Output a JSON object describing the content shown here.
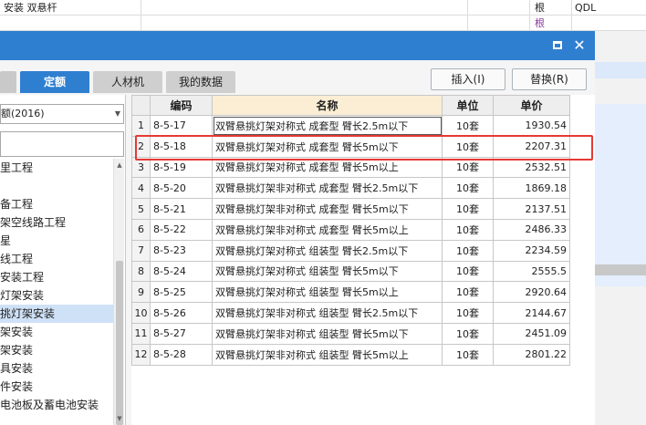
{
  "background": {
    "row1_text": "安装 双悬杆",
    "row1_unit": "根",
    "row1_code": "QDL",
    "row2_unit": "根"
  },
  "dialog": {
    "tabs": {
      "blank": "",
      "quota": "定额",
      "material": "人材机",
      "mydata": "我的数据"
    },
    "insert_label": "插入(I)",
    "replace_label": "替换(R)",
    "library_select": "额(2016)",
    "tree_items": [
      "里工程",
      "",
      "备工程",
      "架空线路工程",
      "星",
      "线工程",
      "安装工程",
      "灯架安装",
      "挑灯架安装",
      "架安装",
      "架安装",
      "具安装",
      "件安装",
      "电池板及蓄电池安装"
    ],
    "selected_tree_index": 8
  },
  "grid": {
    "headers": {
      "index": "",
      "code": "编码",
      "name": "名称",
      "unit": "单位",
      "price": "单价"
    },
    "rows": [
      {
        "index": "1",
        "code": "8-5-17",
        "name": "双臂悬挑灯架对称式 成套型 臂长2.5m以下",
        "unit": "10套",
        "price": "1930.54"
      },
      {
        "index": "2",
        "code": "8-5-18",
        "name": "双臂悬挑灯架对称式 成套型 臂长5m以下",
        "unit": "10套",
        "price": "2207.31"
      },
      {
        "index": "3",
        "code": "8-5-19",
        "name": "双臂悬挑灯架对称式 成套型 臂长5m以上",
        "unit": "10套",
        "price": "2532.51"
      },
      {
        "index": "4",
        "code": "8-5-20",
        "name": "双臂悬挑灯架非对称式 成套型 臂长2.5m以下",
        "unit": "10套",
        "price": "1869.18"
      },
      {
        "index": "5",
        "code": "8-5-21",
        "name": "双臂悬挑灯架非对称式 成套型 臂长5m以下",
        "unit": "10套",
        "price": "2137.51"
      },
      {
        "index": "6",
        "code": "8-5-22",
        "name": "双臂悬挑灯架非对称式 成套型 臂长5m以上",
        "unit": "10套",
        "price": "2486.33"
      },
      {
        "index": "7",
        "code": "8-5-23",
        "name": "双臂悬挑灯架对称式 组装型 臂长2.5m以下",
        "unit": "10套",
        "price": "2234.59"
      },
      {
        "index": "8",
        "code": "8-5-24",
        "name": "双臂悬挑灯架对称式 组装型 臂长5m以下",
        "unit": "10套",
        "price": "2555.5"
      },
      {
        "index": "9",
        "code": "8-5-25",
        "name": "双臂悬挑灯架对称式 组装型 臂长5m以上",
        "unit": "10套",
        "price": "2920.64"
      },
      {
        "index": "10",
        "code": "8-5-26",
        "name": "双臂悬挑灯架非对称式 组装型 臂长2.5m以下",
        "unit": "10套",
        "price": "2144.67"
      },
      {
        "index": "11",
        "code": "8-5-27",
        "name": "双臂悬挑灯架非对称式 组装型 臂长5m以下",
        "unit": "10套",
        "price": "2451.09"
      },
      {
        "index": "12",
        "code": "8-5-28",
        "name": "双臂悬挑灯架非对称式 组装型 臂长5m以上",
        "unit": "10套",
        "price": "2801.22"
      }
    ]
  },
  "colors": {
    "title_bar": "#2f7fd0",
    "active_tab": "#2f7fd0",
    "highlight_border": "#e53935",
    "name_header": "#fbeed4"
  }
}
